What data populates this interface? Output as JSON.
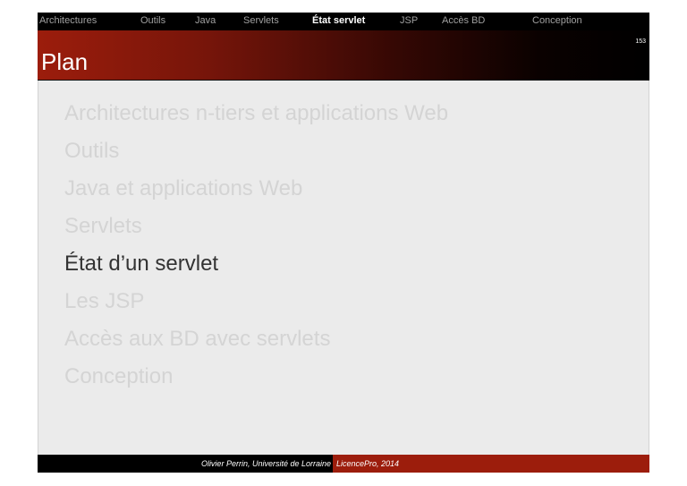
{
  "nav": {
    "items": [
      {
        "label": "Architectures",
        "active": false
      },
      {
        "label": "Outils",
        "active": false
      },
      {
        "label": "Java",
        "active": false
      },
      {
        "label": "Servlets",
        "active": false
      },
      {
        "label": "État servlet",
        "active": true
      },
      {
        "label": "JSP",
        "active": false
      },
      {
        "label": "Accès BD",
        "active": false
      },
      {
        "label": "Conception",
        "active": false
      }
    ]
  },
  "slide": {
    "title": "Plan",
    "page_number": "153"
  },
  "outline": {
    "items": [
      {
        "label": "Architectures n-tiers et applications Web",
        "current": false
      },
      {
        "label": "Outils",
        "current": false
      },
      {
        "label": "Java et applications Web",
        "current": false
      },
      {
        "label": "Servlets",
        "current": false
      },
      {
        "label": "État d’un servlet",
        "current": true
      },
      {
        "label": "Les JSP",
        "current": false
      },
      {
        "label": "Accès aux BD avec servlets",
        "current": false
      },
      {
        "label": "Conception",
        "current": false
      }
    ]
  },
  "footer": {
    "author": "Olivier Perrin, Université de Lorraine",
    "course": "LicencePro, 2014"
  },
  "colors": {
    "accent": "#9c1d0c",
    "nav-bg": "#000000",
    "content-bg": "#ebebeb",
    "faded-text": "#d4d4d4",
    "current-text": "#333333",
    "nav-inactive": "#a0a0a0"
  }
}
